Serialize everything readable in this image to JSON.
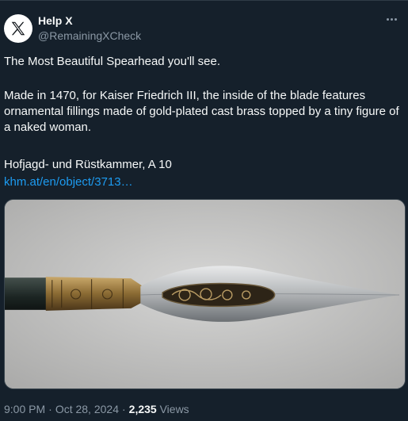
{
  "author": {
    "name": "Help X",
    "handle": "@RemainingXCheck"
  },
  "tweet": {
    "line1": "The Most Beautiful Spearhead you'll see.",
    "line2": "Made in 1470, for Kaiser Friedrich III, the inside of the blade features ornamental fillings made of gold-plated cast brass topped by a tiny figure of a naked woman.",
    "line3": "Hofjagd- und Rüstkammer, A 10",
    "link": "khm.at/en/object/3713…"
  },
  "meta": {
    "time": "9:00 PM",
    "date": "Oct 28, 2024",
    "views_count": "2,235",
    "views_label": "Views"
  },
  "icons": {
    "avatar": "x-logo-icon",
    "more": "more-horizontal-icon"
  },
  "colors": {
    "background": "#15202b",
    "text": "#f7f9f9",
    "secondary": "#8b98a5",
    "link": "#1d9bf0"
  }
}
